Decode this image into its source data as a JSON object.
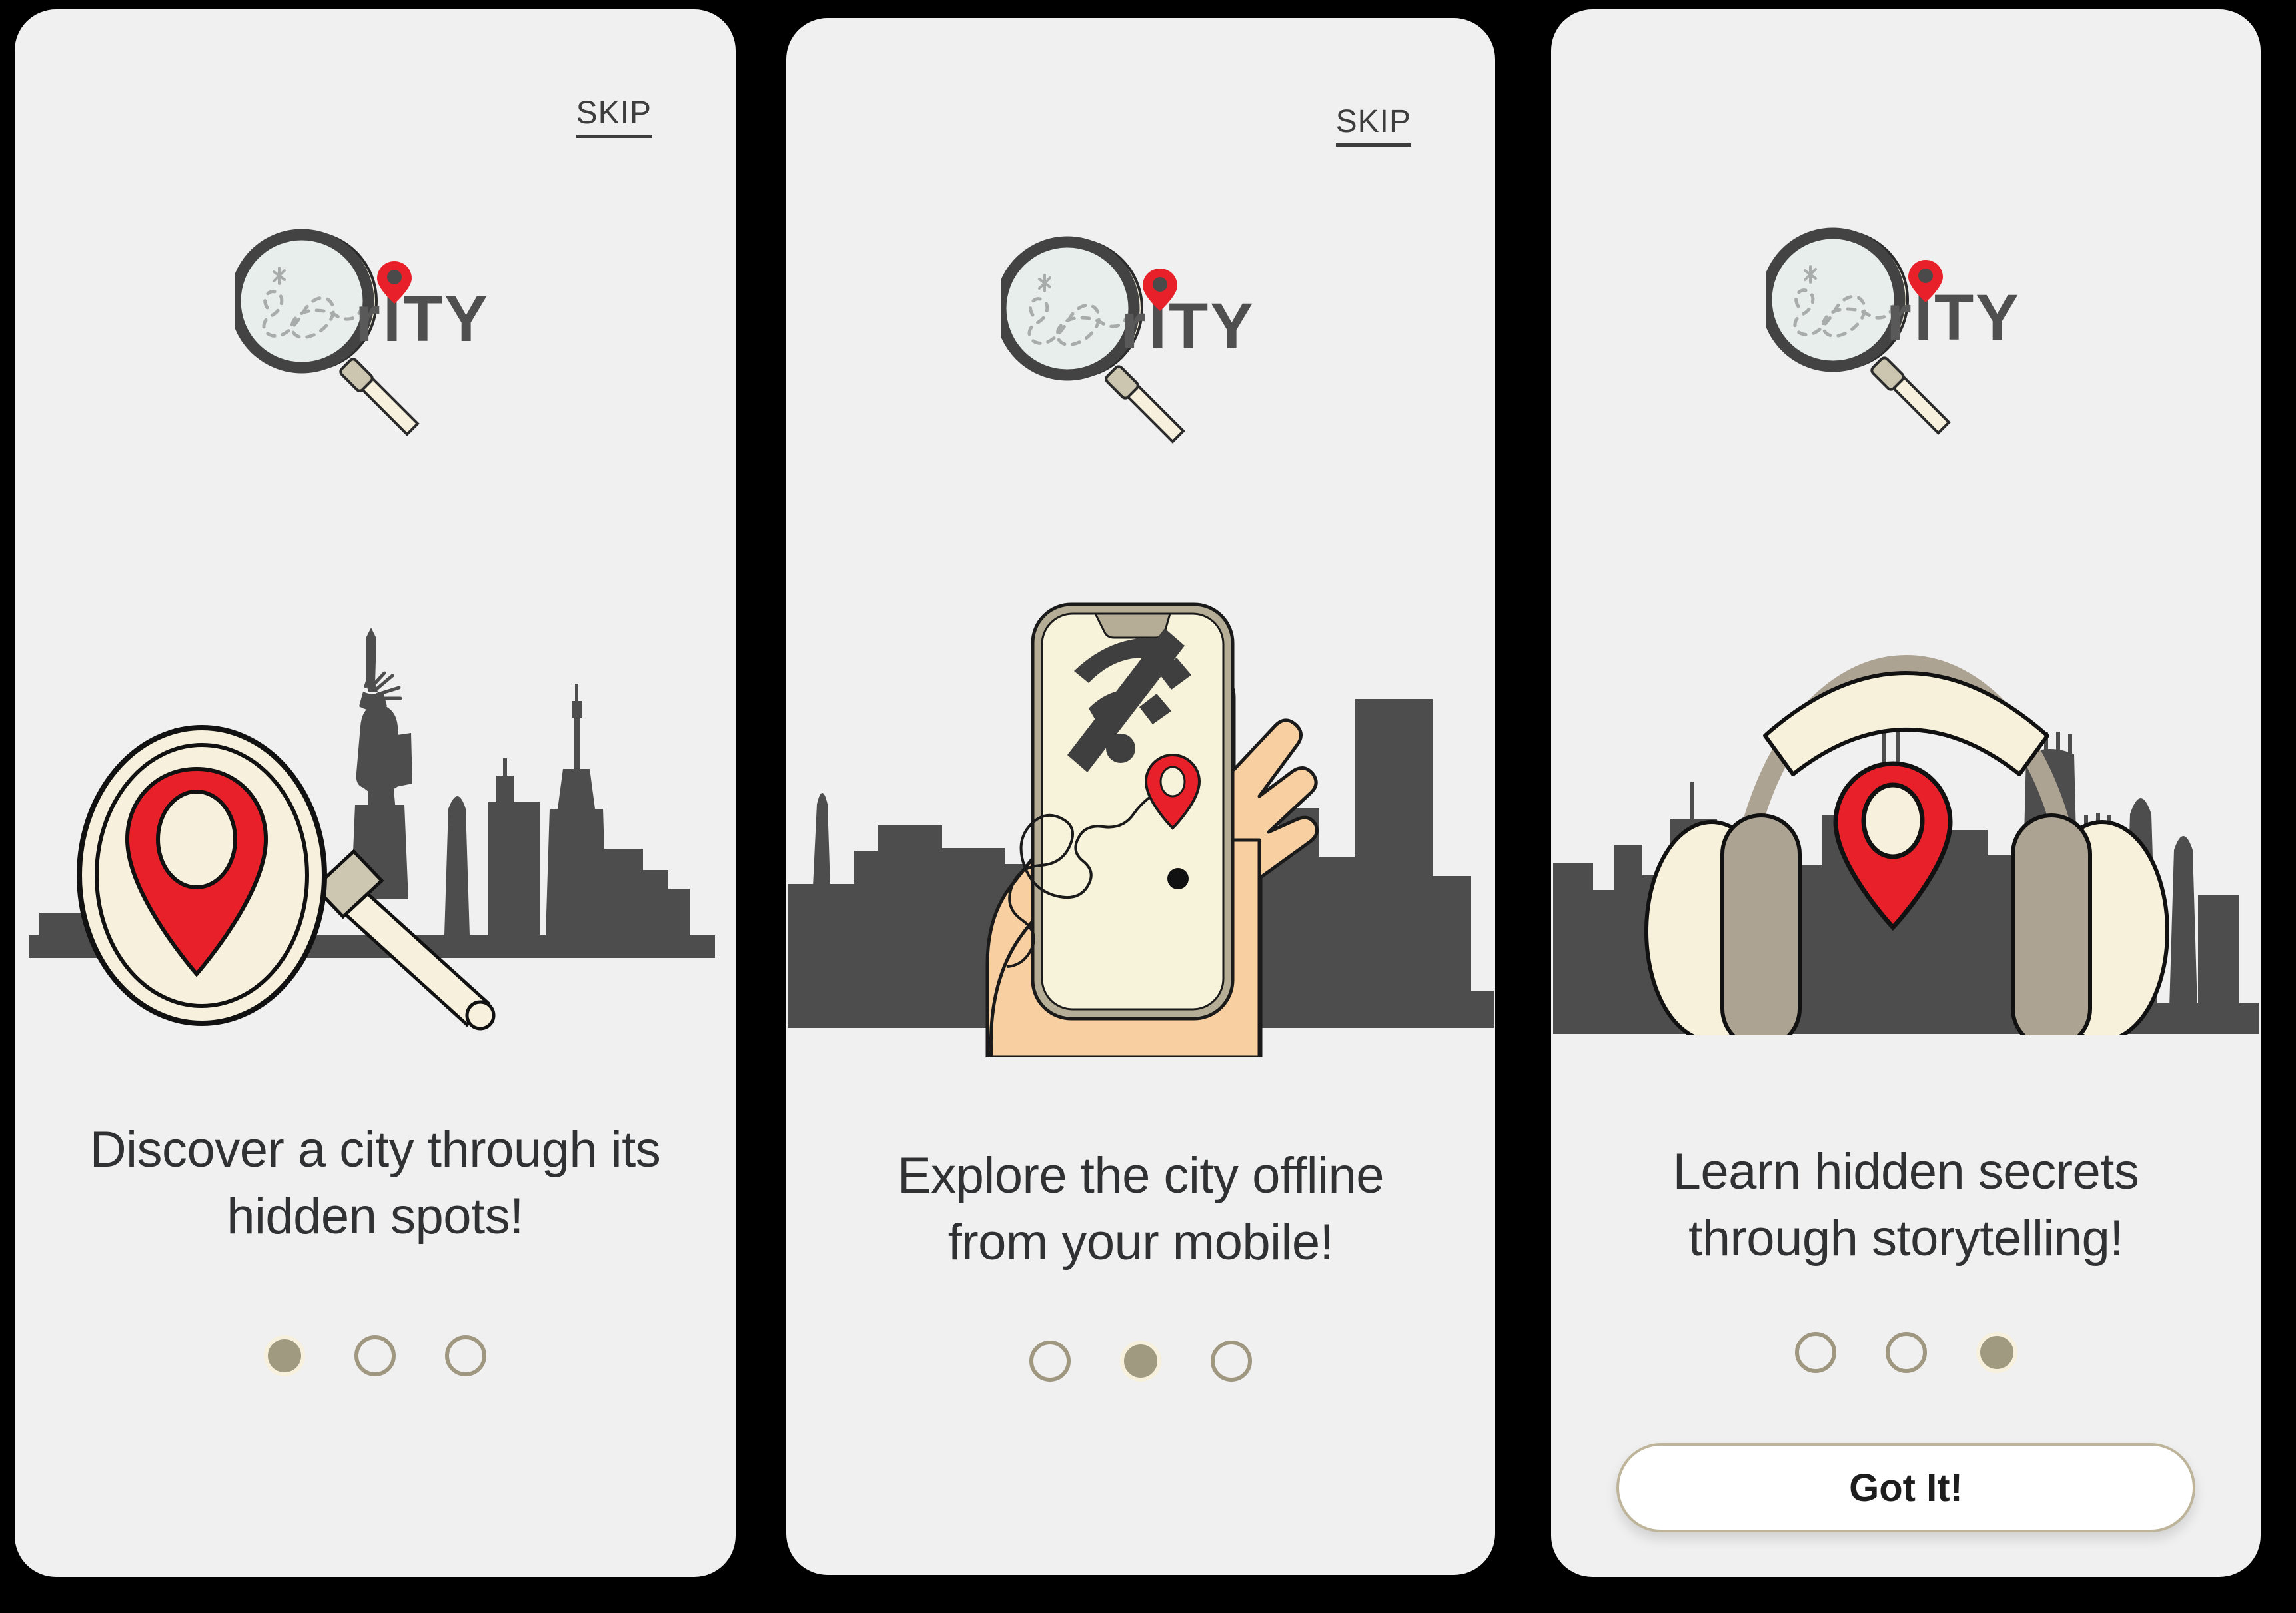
{
  "theme": {
    "page_background": "#000000",
    "card_background": "#f0f0f0",
    "text_color": "#2f3133",
    "accent_taupe": "#a09a80",
    "accent_cream": "#f6f0dd",
    "pin_red": "#e8202a",
    "skyline_gray": "#4d4d4d",
    "skyline_gray_light": "#a9a69c",
    "skin_tone": "#f7cfa0",
    "phone_screen": "#f7f2da"
  },
  "cards": [
    {
      "id": "onboarding-slide-1",
      "skip_label": "SKIP",
      "has_skip": true,
      "logo": {
        "alt": "CitYity magnifying glass logo",
        "word": "rITY"
      },
      "illustration": "magnifier-over-nyc-skyline",
      "caption_line_1": "Discover a city through its",
      "caption_line_2": "hidden spots!",
      "dots": [
        "active",
        "inactive",
        "inactive"
      ],
      "has_button": false,
      "button_label": ""
    },
    {
      "id": "onboarding-slide-2",
      "skip_label": "SKIP",
      "has_skip": true,
      "logo": {
        "alt": "CitYity magnifying glass logo",
        "word": "rITY"
      },
      "illustration": "hand-holding-phone-offline-map",
      "caption_line_1": "Explore the city offline",
      "caption_line_2": "from your mobile!",
      "dots": [
        "inactive",
        "active",
        "inactive"
      ],
      "has_button": false,
      "button_label": ""
    },
    {
      "id": "onboarding-slide-3",
      "skip_label": "",
      "has_skip": false,
      "logo": {
        "alt": "CitYity magnifying glass logo",
        "word": "rITY"
      },
      "illustration": "headphones-over-skyline",
      "caption_line_1": "Learn hidden secrets",
      "caption_line_2": "through storytelling!",
      "dots": [
        "inactive",
        "inactive",
        "active"
      ],
      "has_button": true,
      "button_label": "Got It!"
    }
  ],
  "icons": {
    "magnifier": "magnifier-icon",
    "map_pin": "map-pin-icon",
    "wifi_off": "wifi-off-icon",
    "headphones": "headphones-icon",
    "skyline": "city-skyline-icon",
    "statue_of_liberty": "statue-of-liberty-icon",
    "route_path": "route-path-icon",
    "hand": "hand-icon",
    "phone": "smartphone-icon"
  }
}
